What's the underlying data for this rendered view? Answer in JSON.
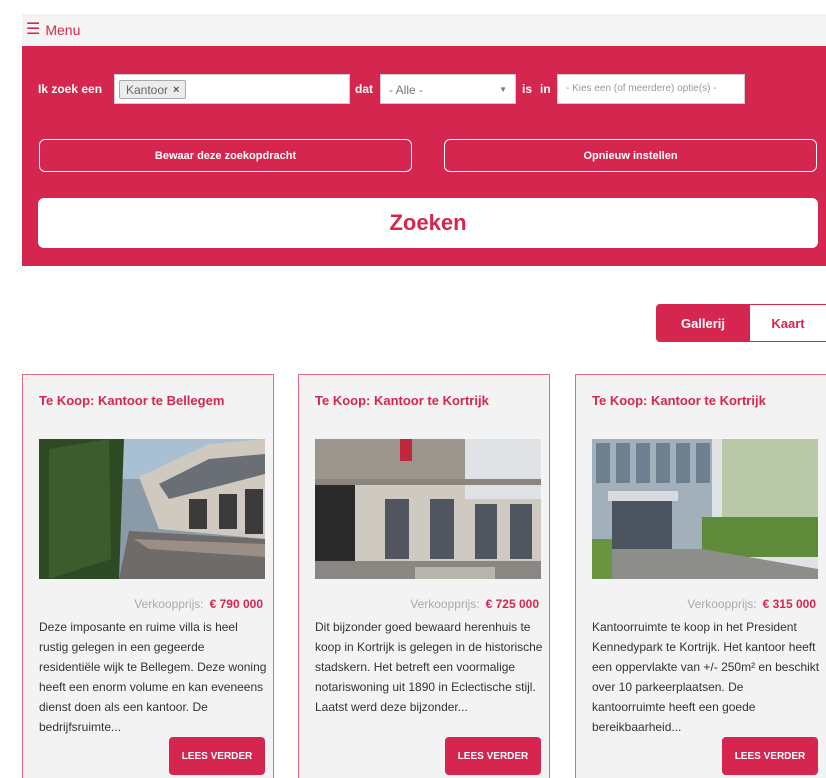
{
  "menu": {
    "icon": "hamburger-icon",
    "label": "Menu"
  },
  "search": {
    "label_zoek": "Ik zoek een",
    "chip": "Kantoor",
    "chip_remove": "×",
    "label_dat": "dat",
    "select_value": "- Alle -",
    "label_is": "is",
    "label_in": "in",
    "location_placeholder": "- Kies een (of meerdere) optie(s) -",
    "save_label": "Bewaar deze zoekopdracht",
    "reset_label": "Opnieuw instellen",
    "submit_label": "Zoeken"
  },
  "view": {
    "gallery": "Gallerij",
    "map": "Kaart"
  },
  "colors": {
    "accent": "#d4264e"
  },
  "price_label": "Verkoopprijs:",
  "more_label": "LEES VERDER",
  "listings": [
    {
      "title": "Te Koop: Kantoor te Bellegem",
      "price": "€ 790 000",
      "description": "Deze imposante en ruime villa is heel rustig gelegen in een gegeerde residentiële wijk te Bellegem. Deze woning heeft een enorm volume en kan eveneens dienst doen als een kantoor. De bedrijfsruimte..."
    },
    {
      "title": "Te Koop: Kantoor te Kortrijk",
      "price": "€ 725 000",
      "description": "Dit bijzonder goed bewaard herenhuis te koop in Kortrijk is gelegen in de historische stadskern. Het betreft een voormalige notariswoning uit 1890 in Eclectische stijl. Laatst werd deze bijzonder..."
    },
    {
      "title": "Te Koop: Kantoor te Kortrijk",
      "price": "€ 315 000",
      "description": "Kantoorruimte te koop in het President Kennedypark te Kortrijk. Het kantoor heeft een oppervlakte van +/- 250m² en beschikt over 10 parkeerplaatsen. De kantoorruimte heeft een goede bereikbaarheid..."
    }
  ]
}
